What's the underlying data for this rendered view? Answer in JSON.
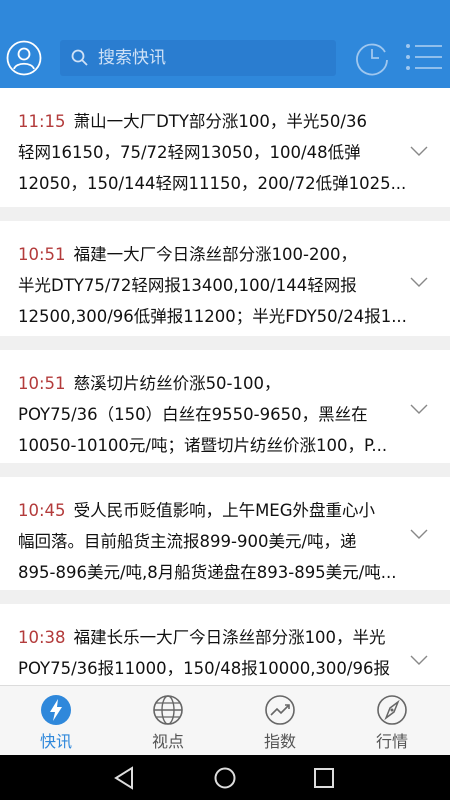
{
  "header": {
    "search_placeholder": "搜索快讯"
  },
  "news": [
    {
      "time": "11:15",
      "line1": "萧山一大厂DTY部分涨100，半光50/36",
      "line2": "轻网16150，75/72轻网13050，100/48低弹",
      "line3": "12050，150/144轻网11150，200/72低弹1025..."
    },
    {
      "time": "10:51",
      "line1": "福建一大厂今日涤丝部分涨100-200，",
      "line2": "半光DTY75/72轻网报13400,100/144轻网报",
      "line3": "12500,300/96低弹报11200；半光FDY50/24报1..."
    },
    {
      "time": "10:51",
      "line1": "慈溪切片纺丝价涨50-100，",
      "line2": "POY75/36（150）白丝在9550-9650，黑丝在",
      "line3": "10050-10100元/吨；诸暨切片纺丝价涨100，P..."
    },
    {
      "time": "10:45",
      "line1": "受人民币贬值影响，上午MEG外盘重心小",
      "line2": "幅回落。目前船货主流报899-900美元/吨，递",
      "line3": "895-896美元/吨,8月船货递盘在893-895美元/吨..."
    },
    {
      "time": "10:38",
      "line1": "福建长乐一大厂今日涤丝部分涨100，半光",
      "line2": "POY75/36报11000，150/48报10000,300/96报",
      "line3": ""
    }
  ],
  "bottom_nav": [
    {
      "label": "快讯",
      "icon": "lightning-icon",
      "active": true
    },
    {
      "label": "视点",
      "icon": "globe-icon",
      "active": false
    },
    {
      "label": "指数",
      "icon": "trend-chart-icon",
      "active": false
    },
    {
      "label": "行情",
      "icon": "compass-icon",
      "active": false
    }
  ],
  "colors": {
    "brand": "#2f88db",
    "time": "#b33b3b",
    "background": "#f0f0f0"
  }
}
